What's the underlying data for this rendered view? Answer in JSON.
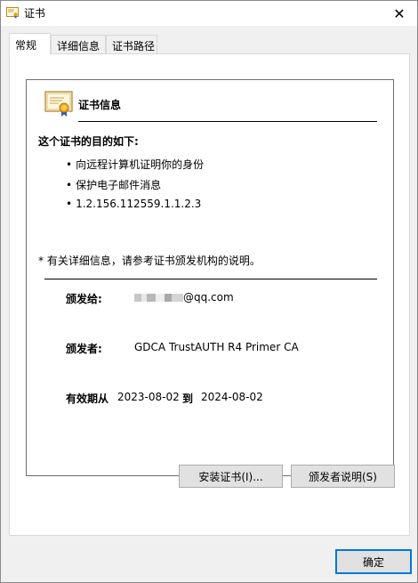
{
  "window": {
    "title": "证书",
    "close_glyph": "✕"
  },
  "tabs": [
    {
      "label": "常规",
      "active": true
    },
    {
      "label": "详细信息",
      "active": false
    },
    {
      "label": "证书路径",
      "active": false
    }
  ],
  "general": {
    "heading": "证书信息",
    "purpose_title": "这个证书的目的如下:",
    "purposes": [
      "向远程计算机证明你的身份",
      "保护电子邮件消息",
      "1.2.156.112559.1.1.2.3"
    ],
    "note": "* 有关详细信息，请参考证书颁发机构的说明。",
    "issued_to_label": "颁发给:",
    "issued_to_value": "@qq.com",
    "issued_by_label": "颁发者:",
    "issued_by_value": "GDCA TrustAUTH R4 Primer CA",
    "valid_from_label": "有效期从",
    "valid_from": "2023-08-02",
    "valid_to_label": "到",
    "valid_to": "2024-08-02"
  },
  "buttons": {
    "install": "安装证书(I)...",
    "issuer_statement": "颁发者说明(S)",
    "ok": "确定"
  },
  "icons": {
    "title": "certificate-icon",
    "cert": "certificate-icon",
    "close": "close-icon"
  }
}
